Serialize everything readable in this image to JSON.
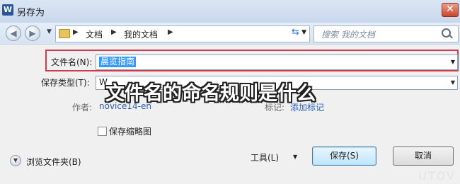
{
  "window": {
    "app_icon": "W",
    "title": "另存为",
    "close_glyph": "✕"
  },
  "nav": {
    "back_glyph": "◀",
    "forward_glyph": "▶",
    "breadcrumb": [
      "文档",
      "我的文档"
    ],
    "search_placeholder": "搜索 我的文档"
  },
  "form": {
    "filename_label": "文件名(N):",
    "filename_value": "晨览指南",
    "filetype_label": "保存类型(T):",
    "filetype_value": "W",
    "author_label": "作者:",
    "author_value": "novice14-en",
    "tags_label": "标记:",
    "tags_value": "添加标记",
    "thumbnail_label": "保存缩略图",
    "thumbnail_checked": false
  },
  "overlay_caption": "文件名的命名规则是什么",
  "footer": {
    "browse_label": "浏览文件夹(B)",
    "tools_label": "工具(L)",
    "save_label": "保存(S)",
    "cancel_label": "取消"
  },
  "watermark": "UTOV",
  "colors": {
    "highlight": "#d43a4e",
    "selection": "#3399ff",
    "link": "#2a5fb3"
  },
  "icons": [
    "word-app-icon",
    "back-icon",
    "forward-icon",
    "folder-icon",
    "refresh-icon",
    "search-icon",
    "chevron-down-icon"
  ]
}
